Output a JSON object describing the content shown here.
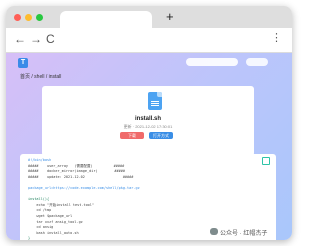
{
  "window": {
    "traffic_colors": {
      "close": "#ff5f57",
      "minimize": "#febc2e",
      "maximize": "#28c840"
    },
    "new_tab_label": "+"
  },
  "toolbar": {
    "back_icon": "arrow-left-icon",
    "forward_icon": "arrow-right-icon",
    "reload_icon": "reload-icon",
    "menu_icon": "kebab-menu-icon",
    "back_glyph": "←",
    "forward_glyph": "→",
    "reload_glyph": "C",
    "menu_glyph": "⋮"
  },
  "site": {
    "logo_text": "T",
    "breadcrumb": "首页 / shell / install",
    "file": {
      "name": "install.sh",
      "meta": "更新 · 2021-12-02 17:30:01",
      "download_label": "下载",
      "open_label": "打开方式"
    },
    "code_lines": [
      {
        "cls": "c-comment",
        "text": "#!/bin/bash"
      },
      {
        "cls": "c-plain",
        "text": "#####    user_array   (需要配置)          #####"
      },
      {
        "cls": "c-plain",
        "text": "#####    docker_mirror(image_dir)        #####"
      },
      {
        "cls": "c-plain",
        "text": "#####    update: 2021-12-02                  #####"
      },
      {
        "cls": "c-plain",
        "text": ""
      },
      {
        "cls": "c-link",
        "text": "package_url=https://code.example.com/shell/pkg.tar.gz"
      },
      {
        "cls": "c-plain",
        "text": ""
      },
      {
        "cls": "c-key",
        "text": "install(){"
      },
      {
        "cls": "c-plain",
        "text": "    echo \"开始install test.tool\""
      },
      {
        "cls": "c-plain",
        "text": "    cd /tmp"
      },
      {
        "cls": "c-plain",
        "text": "    wget $package_url"
      },
      {
        "cls": "c-plain",
        "text": "    tar xvzf ansig_tool.gz"
      },
      {
        "cls": "c-plain",
        "text": "    cd ansig"
      },
      {
        "cls": "c-plain",
        "text": "    bash install_auto.sh"
      },
      {
        "cls": "c-key",
        "text": "}"
      },
      {
        "cls": "c-plain",
        "text": ""
      },
      {
        "cls": "c-plain",
        "text": "install"
      }
    ]
  },
  "watermark": "公众号 · 红帽杰子"
}
